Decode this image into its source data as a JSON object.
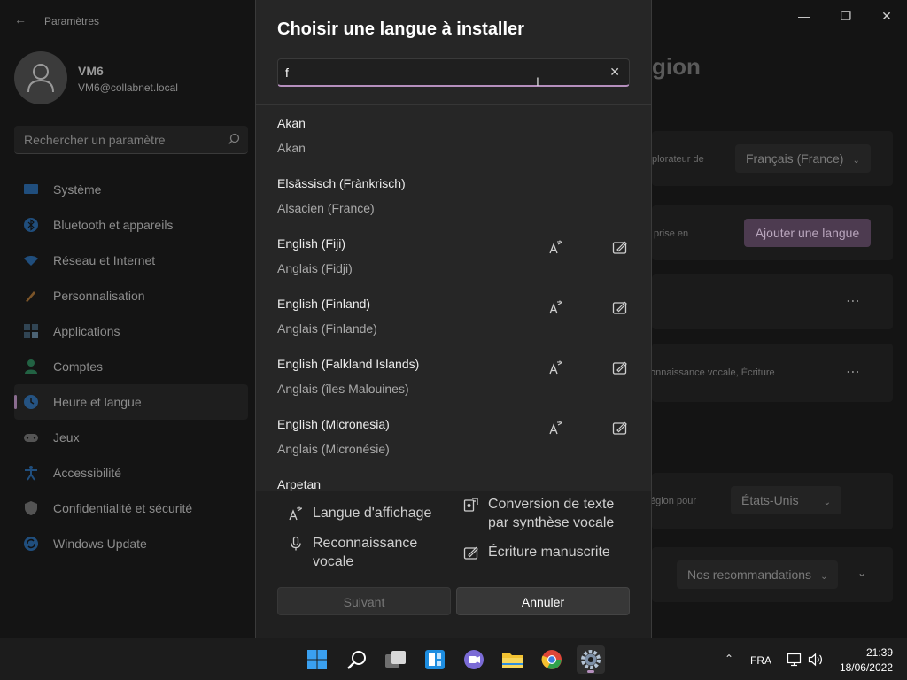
{
  "settings": {
    "app_title": "Paramètres",
    "user": {
      "name": "VM6",
      "email": "VM6@collabnet.local"
    },
    "search_placeholder": "Rechercher un paramètre",
    "nav": [
      {
        "label": "Système",
        "icon": "system-icon",
        "color": "#2b7fd4"
      },
      {
        "label": "Bluetooth et appareils",
        "icon": "bluetooth-icon",
        "color": "#2b7fd4"
      },
      {
        "label": "Réseau et Internet",
        "icon": "wifi-icon",
        "color": "#2b7fd4"
      },
      {
        "label": "Personnalisation",
        "icon": "brush-icon",
        "color": "#d08a3a"
      },
      {
        "label": "Applications",
        "icon": "apps-icon",
        "color": "#4a6d8a"
      },
      {
        "label": "Comptes",
        "icon": "accounts-icon",
        "color": "#2fa36b"
      },
      {
        "label": "Heure et langue",
        "icon": "clock-globe-icon",
        "color": "#2b7fd4"
      },
      {
        "label": "Jeux",
        "icon": "gamepad-icon",
        "color": "#8a8a8a"
      },
      {
        "label": "Accessibilité",
        "icon": "accessibility-icon",
        "color": "#2b7fd4"
      },
      {
        "label": "Confidentialité et sécurité",
        "icon": "shield-icon",
        "color": "#8a8a8a"
      },
      {
        "label": "Windows Update",
        "icon": "update-icon",
        "color": "#2b7fd4"
      }
    ],
    "active_nav_index": 6,
    "content": {
      "title_fragment": "gion",
      "row1_text": "plorateur de",
      "row1_dropdown": "Français (France)",
      "row2_text": "prise en",
      "add_language": "Ajouter une langue",
      "row4_text": "onnaissance vocale, Écriture",
      "row5_text": "égion pour",
      "row5_dropdown": "États-Unis",
      "row6_dropdown": "Nos recommandations"
    }
  },
  "dialog": {
    "title": "Choisir une langue à installer",
    "search_value": "f",
    "languages": [
      {
        "native": "Akan",
        "local": "Akan",
        "display": false,
        "handwriting": false
      },
      {
        "native": "Elsässisch (Frànkrisch)",
        "local": "Alsacien (France)",
        "display": false,
        "handwriting": false
      },
      {
        "native": "English (Fiji)",
        "local": "Anglais (Fidji)",
        "display": true,
        "handwriting": true
      },
      {
        "native": "English (Finland)",
        "local": "Anglais (Finlande)",
        "display": true,
        "handwriting": true
      },
      {
        "native": "English (Falkland Islands)",
        "local": "Anglais (îles Malouines)",
        "display": true,
        "handwriting": true
      },
      {
        "native": "English (Micronesia)",
        "local": "Anglais (Micronésie)",
        "display": true,
        "handwriting": true
      },
      {
        "native": "Arpetan",
        "local": "",
        "display": false,
        "handwriting": false
      }
    ],
    "features": {
      "display_language": "Langue d'affichage",
      "speech_recognition": "Reconnaissance vocale",
      "text_to_speech": "Conversion de texte par synthèse vocale",
      "handwriting": "Écriture manuscrite"
    },
    "buttons": {
      "next": "Suivant",
      "cancel": "Annuler"
    }
  },
  "taskbar": {
    "apps": [
      "start-icon",
      "search-icon",
      "task-view-icon",
      "widgets-icon",
      "teams-chat-icon",
      "file-explorer-icon",
      "chrome-icon",
      "settings-icon"
    ],
    "active_app": "settings-icon",
    "language": "FRA",
    "time": "21:39",
    "date": "18/06/2022"
  },
  "colors": {
    "accent": "#b58fbd",
    "dialog_bg": "#262626",
    "background": "#141414"
  }
}
